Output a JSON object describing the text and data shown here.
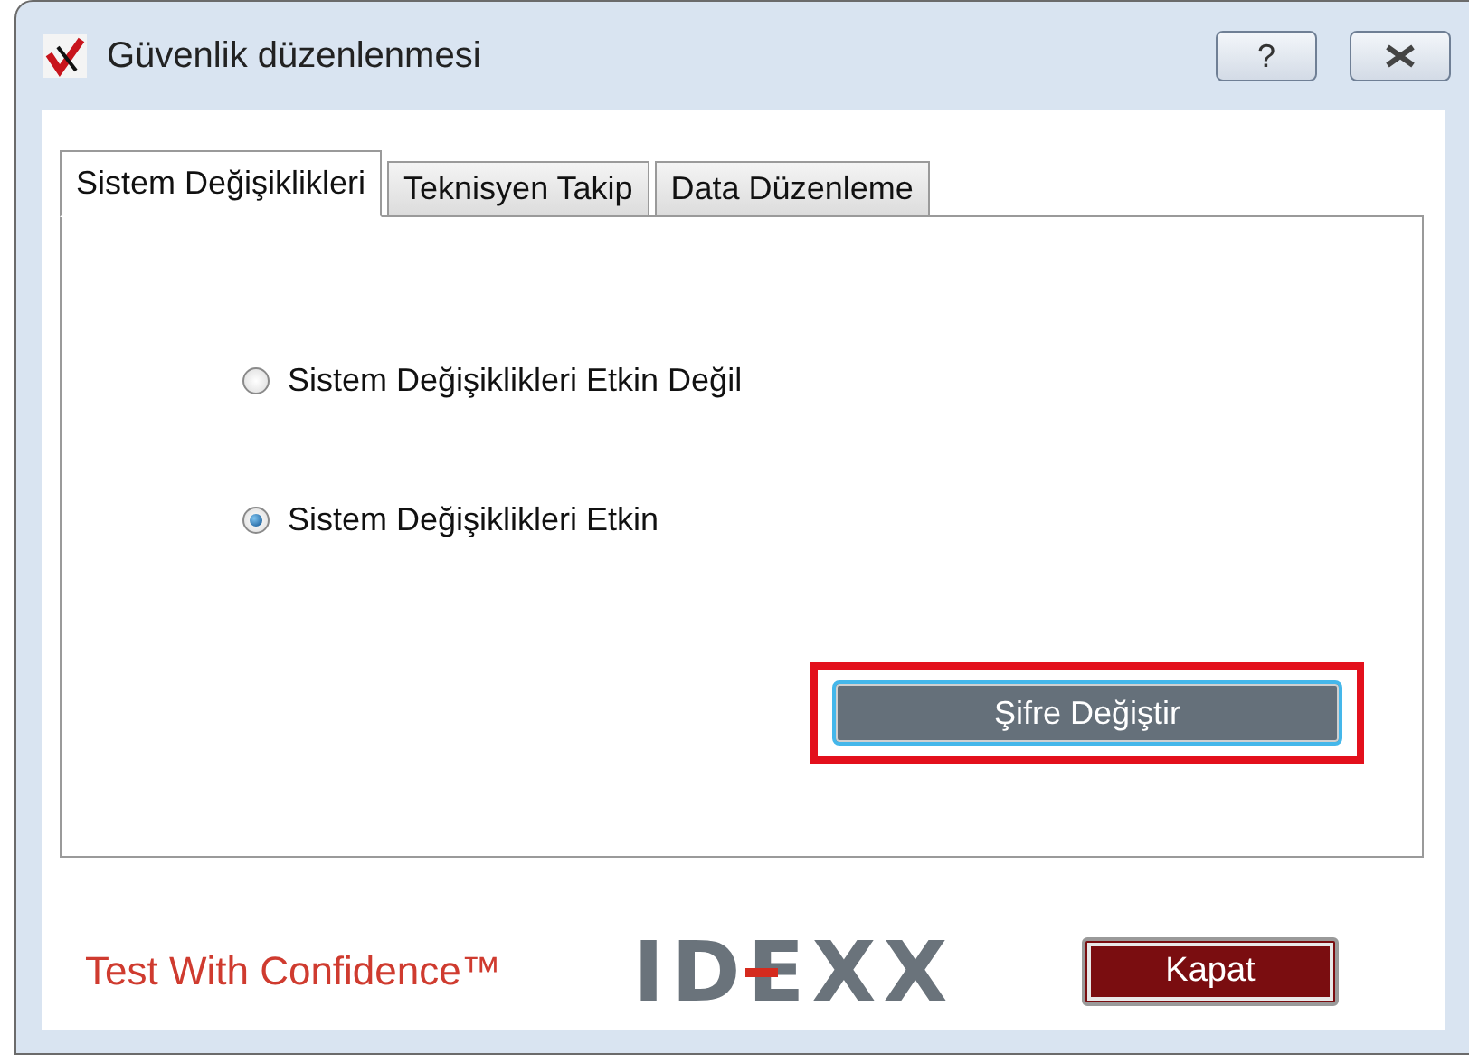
{
  "window": {
    "title": "Güvenlik düzenlenmesi",
    "help_button": "?"
  },
  "tabs": [
    {
      "label": "Sistem Değişiklikleri",
      "selected": true
    },
    {
      "label": "Teknisyen Takip",
      "selected": false
    },
    {
      "label": "Data Düzenleme",
      "selected": false
    }
  ],
  "options": [
    {
      "label": "Sistem Değişiklikleri Etkin Değil",
      "selected": false
    },
    {
      "label": "Sistem Değişiklikleri Etkin",
      "selected": true
    }
  ],
  "change_password_button": {
    "label": "Şifre Değiştir",
    "highlighted": true
  },
  "footer": {
    "slogan": "Test With Confidence™",
    "logo": "IDEXX",
    "close_button": "Kapat"
  }
}
